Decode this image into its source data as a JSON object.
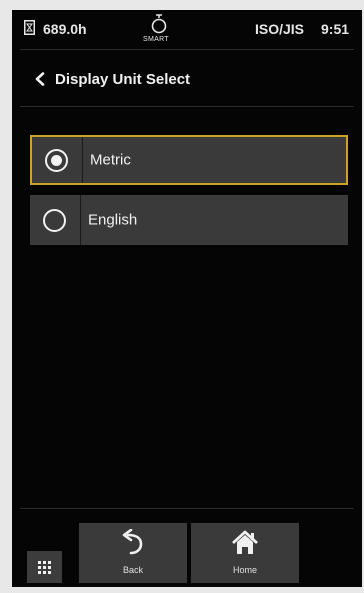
{
  "status_bar": {
    "hours": "689.0h",
    "smart_label": "SMART",
    "standard": "ISO/JIS",
    "time": "9:51",
    "icons": [
      "hour-meter-icon",
      "smart-bulb-icon"
    ]
  },
  "header": {
    "title": "Display Unit Select",
    "icon": "chevron-left-icon"
  },
  "options": [
    {
      "label": "Metric",
      "selected": true
    },
    {
      "label": "English",
      "selected": false
    }
  ],
  "footer": {
    "menu_icon": "grid-menu-icon",
    "back_label": "Back",
    "back_icon": "undo-arrow-icon",
    "home_label": "Home",
    "home_icon": "home-icon"
  },
  "colors": {
    "background": "#050505",
    "option_bg": "#3a3a3a",
    "selected_border": "#c9a227",
    "text": "#f0f0f0"
  }
}
